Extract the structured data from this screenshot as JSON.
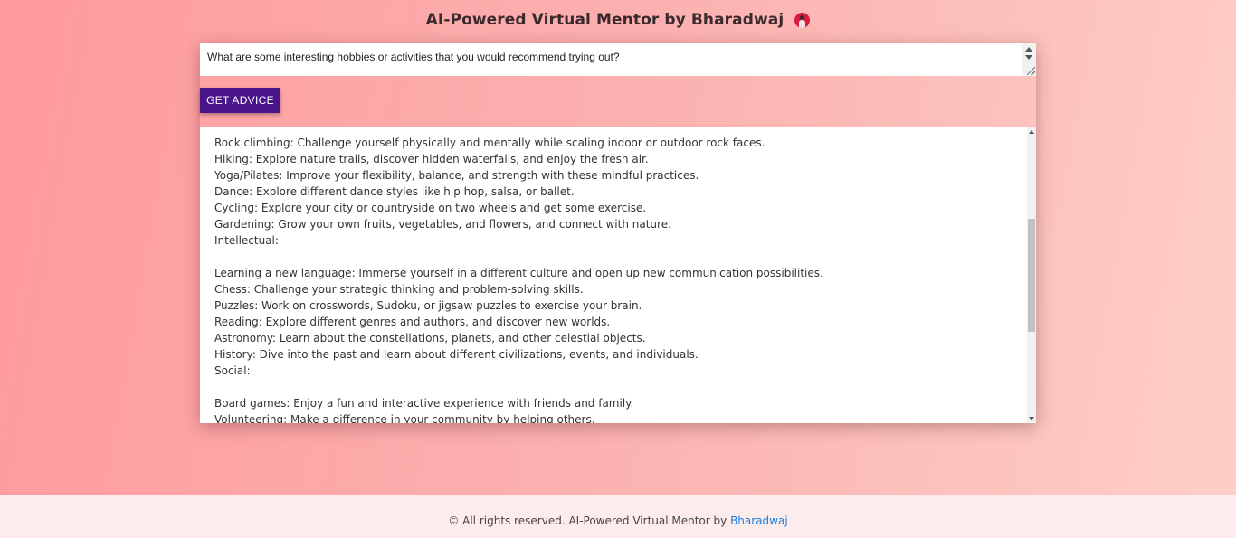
{
  "header": {
    "title": "AI-Powered Virtual Mentor by Bharadwaj",
    "avatar_icon": "avatar-icon"
  },
  "question": {
    "value": "What are some interesting hobbies or activities that you would recommend trying out?"
  },
  "button": {
    "label": "GET ADVICE",
    "color": "#4a148c"
  },
  "response": {
    "lines": [
      "Rock climbing: Challenge yourself physically and mentally while scaling indoor or outdoor rock faces.",
      "Hiking: Explore nature trails, discover hidden waterfalls, and enjoy the fresh air.",
      "Yoga/Pilates: Improve your flexibility, balance, and strength with these mindful practices.",
      "Dance: Explore different dance styles like hip hop, salsa, or ballet.",
      "Cycling: Explore your city or countryside on two wheels and get some exercise.",
      "Gardening: Grow your own fruits, vegetables, and flowers, and connect with nature.",
      "Intellectual:",
      "",
      "Learning a new language: Immerse yourself in a different culture and open up new communication possibilities.",
      "Chess: Challenge your strategic thinking and problem-solving skills.",
      "Puzzles: Work on crosswords, Sudoku, or jigsaw puzzles to exercise your brain.",
      "Reading: Explore different genres and authors, and discover new worlds.",
      "Astronomy: Learn about the constellations, planets, and other celestial objects.",
      "History: Dive into the past and learn about different civilizations, events, and individuals.",
      "Social:",
      "",
      "Board games: Enjoy a fun and interactive experience with friends and family.",
      "Volunteering: Make a difference in your community by helping others."
    ]
  },
  "footer": {
    "text": "© All rights reserved. AI-Powered Virtual Mentor by ",
    "link": "Bharadwaj",
    "link_color": "#1e7be0"
  }
}
